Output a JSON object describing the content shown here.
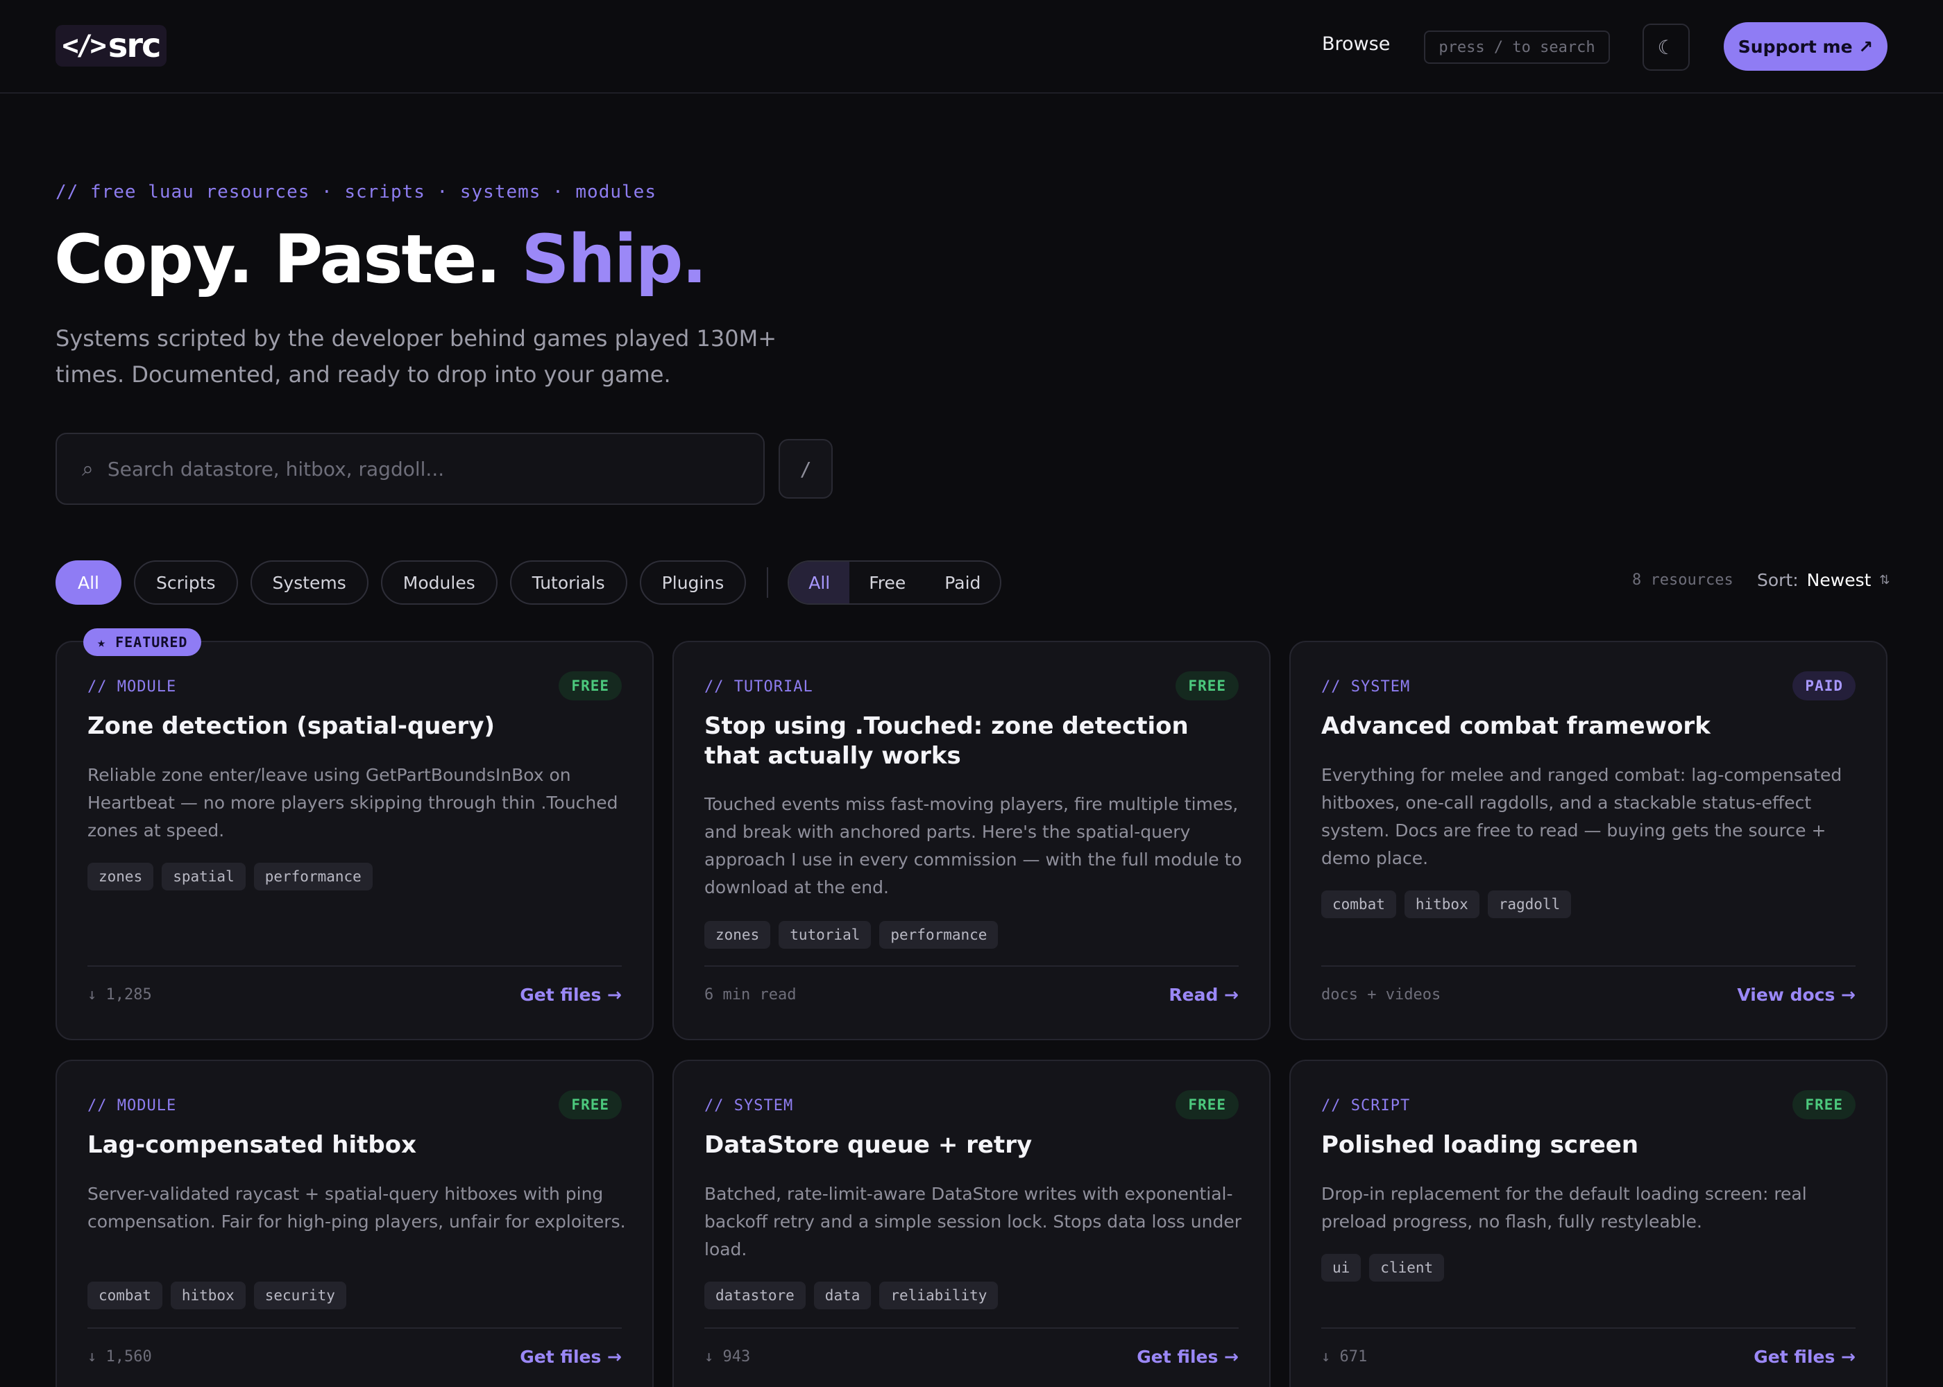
{
  "header": {
    "logo_glyph": "</>",
    "logo_text": "src",
    "browse": "Browse",
    "search_hint": "press / to search",
    "theme_icon": "☾",
    "support": "Support me ↗"
  },
  "hero": {
    "kicker": "// free luau resources · scripts · systems · modules",
    "title_a": "Copy. Paste. ",
    "title_b": "Ship.",
    "subtitle": "Systems scripted by the developer behind games played 130M+ times. Documented, and ready to drop into your game.",
    "search_placeholder": "Search datastore, hitbox, ragdoll...",
    "search_icon": "⌕",
    "slash": "/"
  },
  "filters": {
    "categories": [
      "All",
      "Scripts",
      "Systems",
      "Modules",
      "Tutorials",
      "Plugins"
    ],
    "pricing": [
      "All",
      "Free",
      "Paid"
    ],
    "count": "8 resources",
    "sort_label": "Sort:",
    "sort_value": "Newest",
    "sort_icon": "⇅"
  },
  "featured_label": "★ FEATURED",
  "cards": [
    {
      "type": "// MODULE",
      "badge": "FREE",
      "title": "Zone detection (spatial-query)",
      "desc": "Reliable zone enter/leave using GetPartBoundsInBox on Heartbeat — no more players skipping through thin .Touched zones at speed.",
      "tags": [
        "zones",
        "spatial",
        "performance"
      ],
      "meta": "↓ 1,285",
      "action": "Get files →"
    },
    {
      "type": "// TUTORIAL",
      "badge": "FREE",
      "title": "Stop using .Touched: zone detection that actually works",
      "desc": "Touched events miss fast-moving players, fire multiple times, and break with anchored parts. Here's the spatial-query approach I use in every commission — with the full module to download at the end.",
      "tags": [
        "zones",
        "tutorial",
        "performance"
      ],
      "meta": "6 min read",
      "action": "Read →"
    },
    {
      "type": "// SYSTEM",
      "badge": "PAID",
      "title": "Advanced combat framework",
      "desc": "Everything for melee and ranged combat: lag-compensated hitboxes, one-call ragdolls, and a stackable status-effect system. Docs are free to read — buying gets the source + demo place.",
      "tags": [
        "combat",
        "hitbox",
        "ragdoll"
      ],
      "meta": "docs + videos",
      "action": "View docs →"
    },
    {
      "type": "// MODULE",
      "badge": "FREE",
      "title": "Lag-compensated hitbox",
      "desc": "Server-validated raycast + spatial-query hitboxes with ping compensation. Fair for high-ping players, unfair for exploiters.",
      "tags": [
        "combat",
        "hitbox",
        "security"
      ],
      "meta": "↓ 1,560",
      "action": "Get files →"
    },
    {
      "type": "// SYSTEM",
      "badge": "FREE",
      "title": "DataStore queue + retry",
      "desc": "Batched, rate-limit-aware DataStore writes with exponential-backoff retry and a simple session lock. Stops data loss under load.",
      "tags": [
        "datastore",
        "data",
        "reliability"
      ],
      "meta": "↓ 943",
      "action": "Get files →"
    },
    {
      "type": "// SCRIPT",
      "badge": "FREE",
      "title": "Polished loading screen",
      "desc": "Drop-in replacement for the default loading screen: real preload progress, no flash, fully restyleable.",
      "tags": [
        "ui",
        "client"
      ],
      "meta": "↓ 671",
      "action": "Get files →"
    }
  ]
}
